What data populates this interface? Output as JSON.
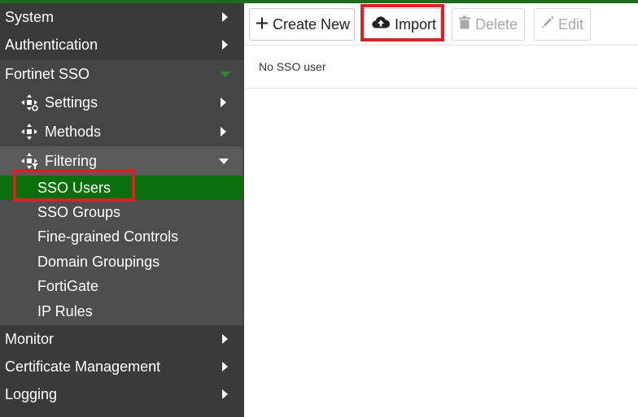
{
  "sidebar": {
    "top_items": [
      {
        "label": "System"
      },
      {
        "label": "Authentication"
      },
      {
        "label": "Fortinet SSO"
      }
    ],
    "sso_children": [
      {
        "label": "Settings",
        "icon": "settings-icon"
      },
      {
        "label": "Methods",
        "icon": "methods-icon"
      },
      {
        "label": "Filtering",
        "icon": "filtering-icon"
      }
    ],
    "filtering_children": [
      {
        "label": "SSO Users",
        "active": true
      },
      {
        "label": "SSO Groups"
      },
      {
        "label": "Fine-grained Controls"
      },
      {
        "label": "Domain Groupings"
      },
      {
        "label": "FortiGate"
      },
      {
        "label": "IP Rules"
      }
    ],
    "bottom_items": [
      {
        "label": "Monitor"
      },
      {
        "label": "Certificate Management"
      },
      {
        "label": "Logging"
      }
    ]
  },
  "toolbar": {
    "create_new_label": "Create New",
    "import_label": "Import",
    "delete_label": "Delete",
    "edit_label": "Edit"
  },
  "main": {
    "empty_text": "No SSO user"
  },
  "colors": {
    "active_green": "#0a6e0a",
    "highlight_red": "#d6232a",
    "sidebar_bg": "#3a3a3a"
  }
}
